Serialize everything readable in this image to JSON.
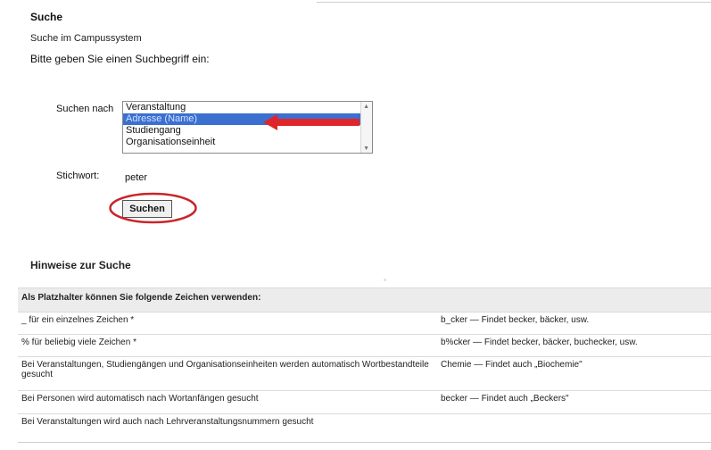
{
  "page": {
    "title": "Suche",
    "subtitle": "Suche im Campussystem",
    "prompt": "Bitte geben Sie einen Suchbegriff ein:"
  },
  "search_form": {
    "search_by_label": "Suchen nach",
    "options": [
      "Veranstaltung",
      "Adresse (Name)",
      "Studiengang",
      "Organisationseinheit"
    ],
    "selected_option": "Adresse (Name)",
    "keyword_label": "Stichwort:",
    "keyword_value": "peter",
    "submit_label": "Suchen"
  },
  "annotations": {
    "arrow_color": "#e0262a",
    "circle_color": "#c8262a"
  },
  "hints": {
    "heading": "Hinweise zur Suche",
    "table_header": "Als Platzhalter können Sie folgende Zeichen verwenden:",
    "rows": [
      {
        "rule": "_ für ein einzelnes Zeichen *",
        "example": "b_cker — Findet becker, bäcker, usw."
      },
      {
        "rule": "% für beliebig viele Zeichen *",
        "example": "b%cker — Findet becker, bäcker, buchecker, usw."
      },
      {
        "rule": "Bei Veranstaltungen, Studiengängen und Organisationseinheiten werden automatisch Wortbestandteile gesucht",
        "example": "Chemie — Findet auch „Biochemie\""
      },
      {
        "rule": "Bei Personen wird automatisch nach Wortanfängen gesucht",
        "example": "becker — Findet auch „Beckers\""
      },
      {
        "rule": "Bei Veranstaltungen wird auch nach Lehrveranstaltungsnummern gesucht",
        "example": ""
      }
    ]
  }
}
